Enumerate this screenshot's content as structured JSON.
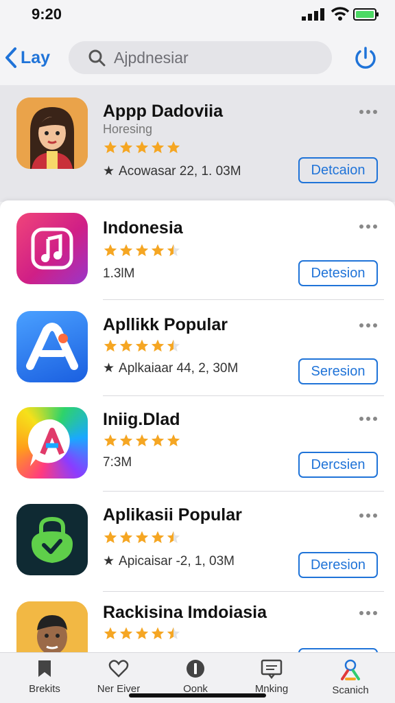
{
  "status_bar": {
    "time": "9:20"
  },
  "nav": {
    "back_label": "Lay",
    "search_placeholder": "Ajpdnesiar"
  },
  "featured": {
    "title": "Appp Dadoviia",
    "subtitle": "Horesing",
    "rating": 5,
    "meta": "Acowasar 22, 1. 03M",
    "button": "Detcaion"
  },
  "apps": [
    {
      "title": "Indonesia",
      "rating": 4.5,
      "meta": "1.3lM",
      "button": "Detesion"
    },
    {
      "title": "Apllikk Popular",
      "rating": 4.5,
      "meta": "Aplkaiaar 44, 2, 30M",
      "button": "Seresion"
    },
    {
      "title": "Iniig.Dlad",
      "rating": 5,
      "meta": "7:3M",
      "button": "Dercsien"
    },
    {
      "title": "Aplikasii Popular",
      "rating": 4.5,
      "meta": "Apicaisar -2, 1, 03M",
      "button": "Deresion"
    },
    {
      "title": "Rackisina Imdoiasia",
      "rating": 4.5
    }
  ],
  "tabs": [
    {
      "label": "Brekits"
    },
    {
      "label": "Ner Eiver"
    },
    {
      "label": "Oonk"
    },
    {
      "label": "Mnking"
    },
    {
      "label": "Scanich"
    }
  ],
  "colors": {
    "accent": "#1f73d8",
    "star": "#f5a623"
  }
}
